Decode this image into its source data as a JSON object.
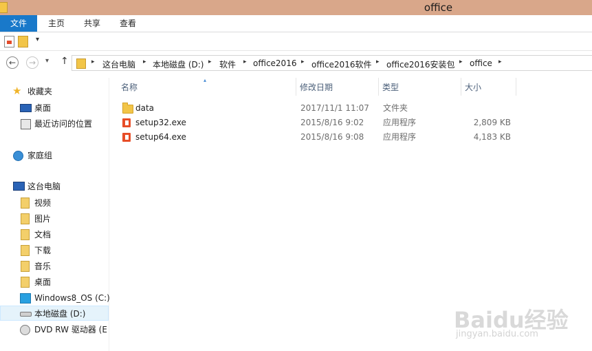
{
  "window": {
    "title": "office"
  },
  "ribbon": {
    "tabs": [
      "文件",
      "主页",
      "共享",
      "查看"
    ]
  },
  "address": {
    "crumbs": [
      "这台电脑",
      "本地磁盘 (D:)",
      "软件",
      "office2016",
      "office2016软件",
      "office2016安装包",
      "office"
    ]
  },
  "sidebar": {
    "favorites": {
      "label": "收藏夹",
      "items": [
        "桌面",
        "最近访问的位置"
      ]
    },
    "homegroup": "家庭组",
    "thispc": {
      "label": "这台电脑",
      "items": [
        "视频",
        "图片",
        "文档",
        "下载",
        "音乐",
        "桌面",
        "Windows8_OS (C:)",
        "本地磁盘 (D:)",
        "DVD RW 驱动器 (E"
      ]
    }
  },
  "columns": {
    "name": "名称",
    "modified": "修改日期",
    "type": "类型",
    "size": "大小"
  },
  "files": [
    {
      "name": "data",
      "modified": "2017/11/1 11:07",
      "type": "文件夹",
      "size": "",
      "icon": "folder-icon"
    },
    {
      "name": "setup32.exe",
      "modified": "2015/8/16 9:02",
      "type": "应用程序",
      "size": "2,809 KB",
      "icon": "office-app-icon"
    },
    {
      "name": "setup64.exe",
      "modified": "2015/8/16 9:08",
      "type": "应用程序",
      "size": "4,183 KB",
      "icon": "office-app-icon"
    }
  ],
  "watermark": {
    "logo": "Baidu经验",
    "url": "jingyan.baidu.com"
  },
  "colors": {
    "titlebar": "#d9a78a",
    "file_tab": "#1979ca",
    "selected": "#e5f3fb"
  }
}
